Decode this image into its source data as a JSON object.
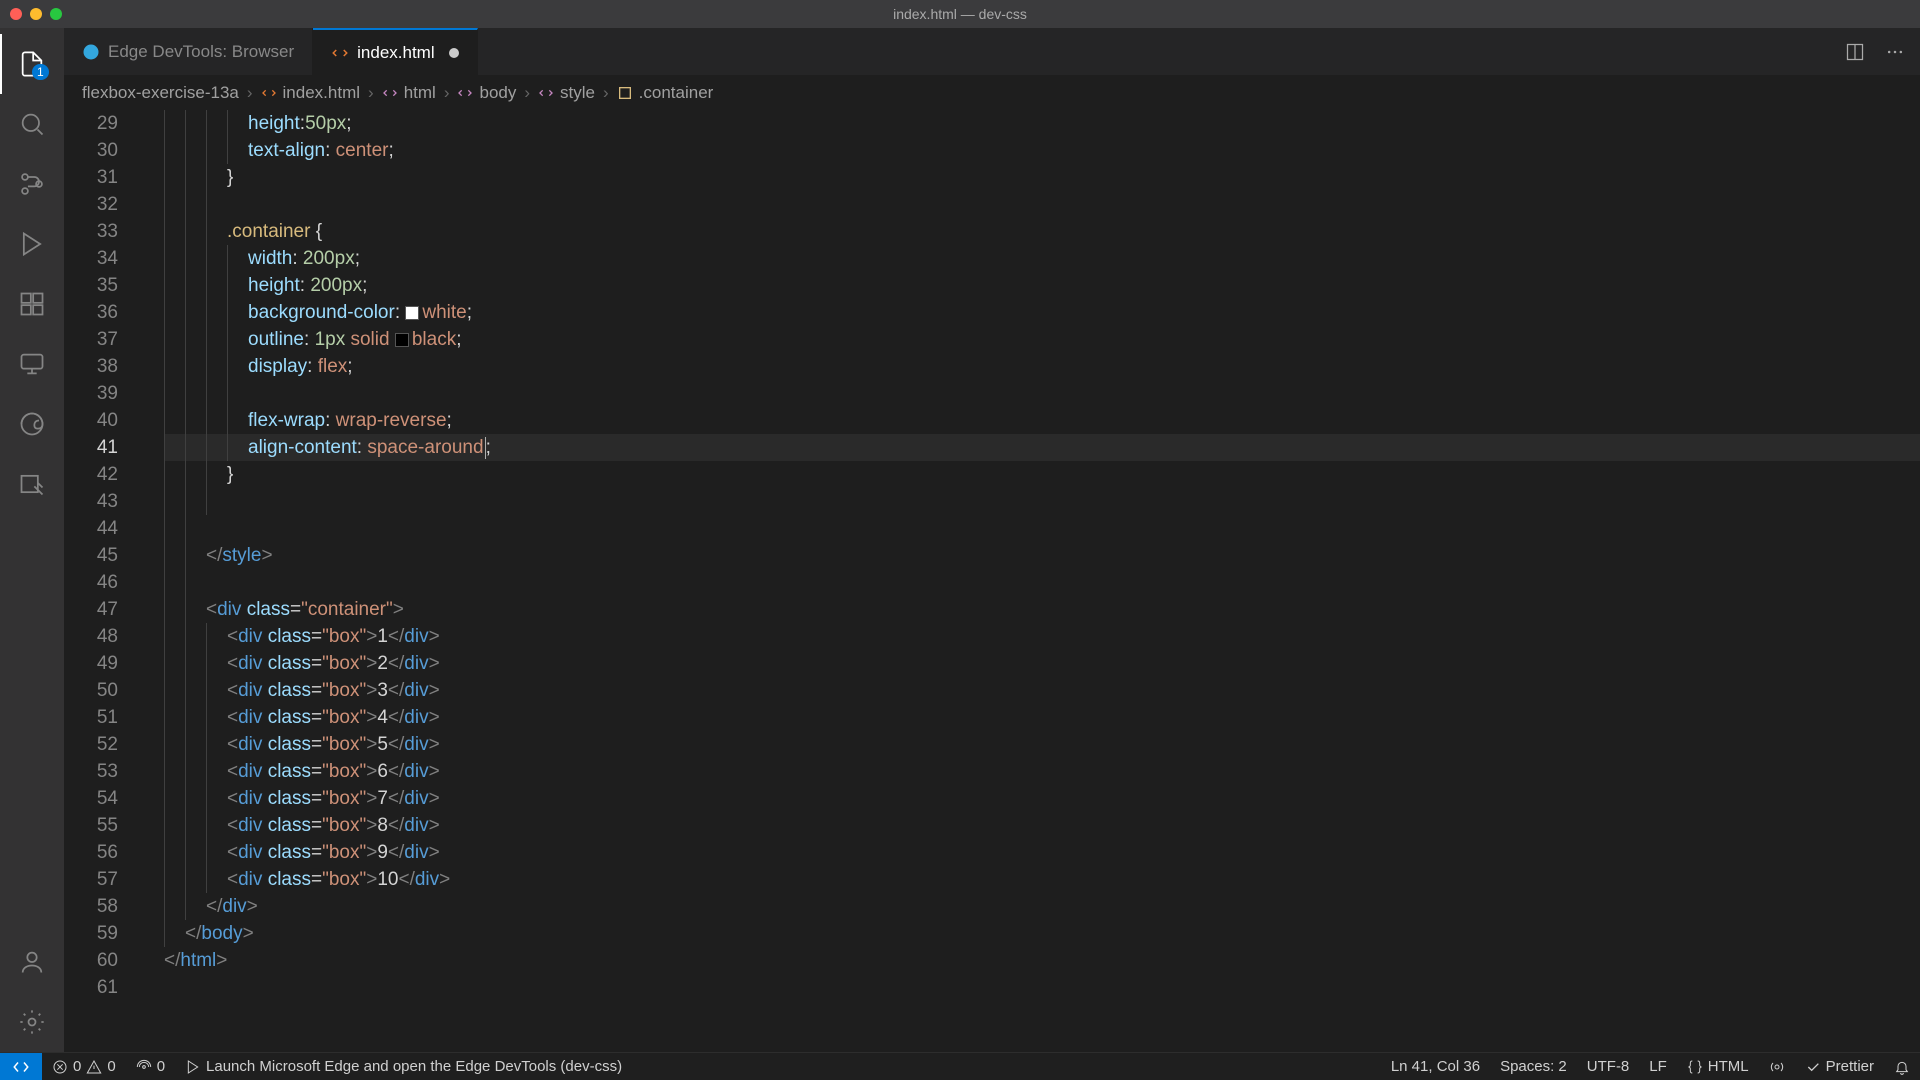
{
  "titlebar": {
    "title": "index.html — dev-css"
  },
  "tabs": {
    "edge": {
      "label": "Edge DevTools: Browser"
    },
    "index": {
      "label": "index.html"
    }
  },
  "breadcrumb": {
    "project": "flexbox-exercise-13a",
    "file": "index.html",
    "node1": "html",
    "node2": "body",
    "node3": "style",
    "node4": ".container"
  },
  "activity": {
    "explorer_badge": "1"
  },
  "code": {
    "startLine": 29,
    "endLine": 61,
    "activeLine": 41,
    "l29": {
      "p": "height",
      "v": "50px"
    },
    "l30": {
      "p": "text-align",
      "v": "center"
    },
    "l33": {
      "sel": ".container"
    },
    "l34": {
      "p": "width",
      "v": "200px"
    },
    "l35": {
      "p": "height",
      "v": "200px"
    },
    "l36": {
      "p": "background-color",
      "v": "white"
    },
    "l37": {
      "p": "outline",
      "v1": "1px",
      "v2": "solid",
      "v3": "black"
    },
    "l38": {
      "p": "display",
      "v": "flex"
    },
    "l40": {
      "p": "flex-wrap",
      "v": "wrap-reverse"
    },
    "l41": {
      "p": "align-content",
      "v": "space-around"
    },
    "l45": {
      "tag": "style"
    },
    "l47": {
      "tag": "div",
      "cls": "container"
    },
    "boxes": [
      "1",
      "2",
      "3",
      "4",
      "5",
      "6",
      "7",
      "8",
      "9",
      "10"
    ],
    "l58": {
      "tag": "div"
    },
    "l59": {
      "tag": "body"
    },
    "l60": {
      "tag": "html"
    }
  },
  "status": {
    "errors": "0",
    "warnings": "0",
    "ports": "0",
    "launch": "Launch Microsoft Edge and open the Edge DevTools (dev-css)",
    "cursor": "Ln 41, Col 36",
    "spaces": "Spaces: 2",
    "encoding": "UTF-8",
    "eol": "LF",
    "lang": "HTML",
    "prettier": "Prettier"
  }
}
